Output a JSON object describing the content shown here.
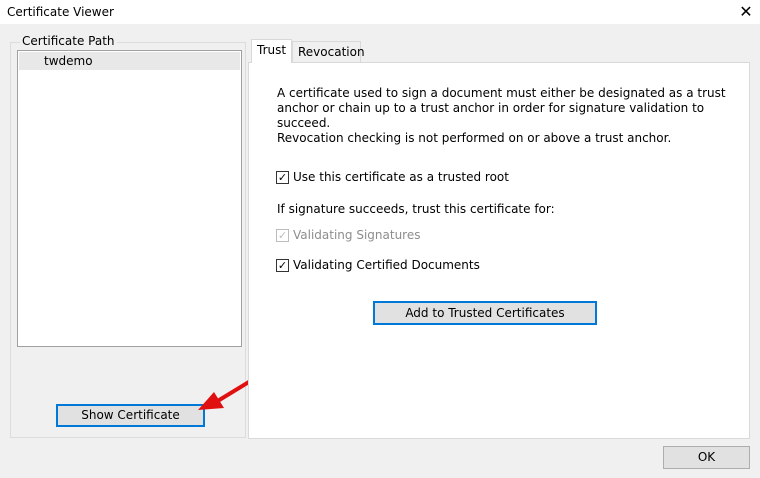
{
  "window": {
    "title": "Certificate Viewer",
    "close_glyph": "✕"
  },
  "cert_path": {
    "legend": "Certificate Path",
    "items": [
      {
        "label": "twdemo"
      }
    ],
    "show_certificate_label": "Show Certificate"
  },
  "tabs": [
    {
      "label": "Trust",
      "selected": true
    },
    {
      "label": "Revocation",
      "selected": false
    }
  ],
  "trust": {
    "description_lines": [
      "A certificate used to sign a document must either be designated as a trust",
      "anchor or chain up to a trust anchor in order for signature validation to succeed.",
      "Revocation checking is not performed on or above a trust anchor."
    ],
    "use_trusted_root": {
      "label": "Use this certificate as a trusted root",
      "checked": true,
      "enabled": true
    },
    "trust_for_label": "If signature succeeds, trust this certificate for:",
    "validating_signatures": {
      "label": "Validating Signatures",
      "checked": true,
      "enabled": false
    },
    "validating_certified": {
      "label": "Validating Certified Documents",
      "checked": true,
      "enabled": true
    },
    "add_trusted_label": "Add to Trusted Certificates"
  },
  "ok_label": "OK",
  "colors": {
    "focus": "#0078d7",
    "annotation_arrow": "#e01010"
  },
  "check_glyph": "✓"
}
